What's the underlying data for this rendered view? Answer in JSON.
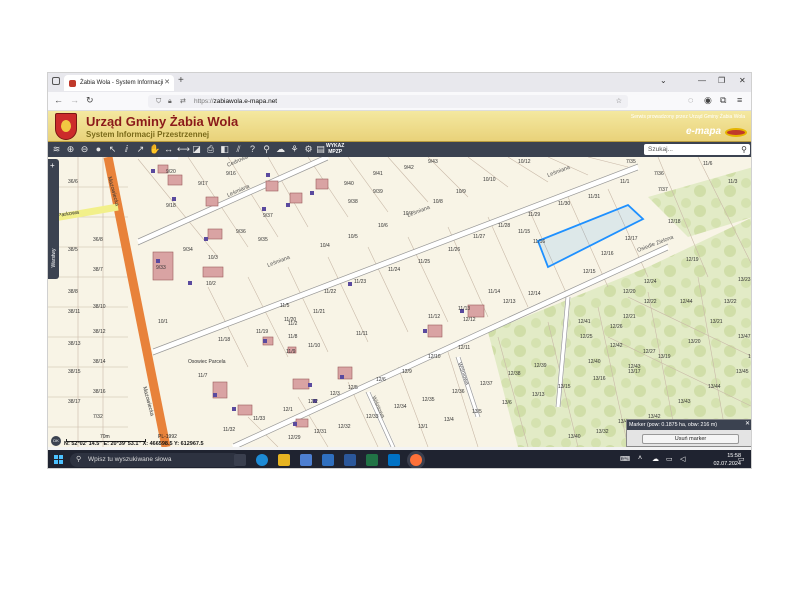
{
  "browser": {
    "tab_title": "Żabia Wola - System Informacji",
    "url_prefix": "https://",
    "url_host": "zabiawola.e-mapa.net"
  },
  "site": {
    "title": "Urząd Gminy Żabia Wola",
    "subtitle": "System Informacji Przestrzennej",
    "powered": "Serwis prowadzony przez Urząd Gminy Żabia Wola",
    "brand": "e-mapa"
  },
  "toolbar": {
    "wykaz_line1": "WYKAZ",
    "wykaz_line2": "MPZP",
    "search_placeholder": "Szukaj..."
  },
  "map": {
    "layers_label": "Warstwy",
    "scale_label": "70m",
    "scale_right": "PL-1992",
    "coords": "N: 52°02' 14.5\"  E: 20°39' 53.1\"  X: 466598.5  Y: 612967.5",
    "streets": [
      "Parkowa",
      "Mazowiecka",
      "Mazowiecka",
      "Leśmiana",
      "Leśmiana",
      "Leśmiana",
      "Leśmiana",
      "Cedrowa",
      "Wiśniowa",
      "Wiśniowa",
      "Osiedle Zielona"
    ],
    "area_label": "Osowiec Parcela",
    "parcels": [
      "9/20",
      "9/18",
      "9/17",
      "9/16",
      "9/34",
      "9/36",
      "9/37",
      "9/35",
      "9/33",
      "9/40",
      "9/41",
      "9/42",
      "9/43",
      "9/38",
      "9/39",
      "10/1",
      "10/2",
      "10/3",
      "10/4",
      "10/5",
      "10/6",
      "10/7",
      "10/8",
      "10/9",
      "10/10",
      "10/12",
      "11/2",
      "11/5",
      "11/7",
      "11/8",
      "11/9",
      "11/10",
      "11/11",
      "11/12",
      "11/13",
      "11/14",
      "11/15",
      "11/16",
      "11/18",
      "11/19",
      "11/20",
      "11/21",
      "11/22",
      "11/23",
      "11/24",
      "11/25",
      "11/26",
      "11/27",
      "11/28",
      "11/29",
      "11/30",
      "11/31",
      "11/32",
      "11/33",
      "12/1",
      "12/2",
      "12/3",
      "12/5",
      "12/6",
      "12/9",
      "12/10",
      "12/11",
      "12/12",
      "12/13",
      "12/14",
      "12/15",
      "12/16",
      "12/17",
      "12/18",
      "12/19",
      "12/20",
      "12/21",
      "12/22",
      "12/24",
      "12/25",
      "12/26",
      "12/27",
      "12/29",
      "12/31",
      "12/32",
      "12/33",
      "12/34",
      "12/35",
      "12/36",
      "12/37",
      "12/38",
      "12/39",
      "12/40",
      "12/41",
      "12/42",
      "12/43",
      "12/44",
      "13/1",
      "13/4",
      "13/5",
      "13/6",
      "13/13",
      "13/15",
      "13/16",
      "13/17",
      "13/19",
      "13/20",
      "13/21",
      "13/22",
      "13/23",
      "13/32",
      "13/40",
      "13/41",
      "13/42",
      "13/43",
      "13/44",
      "13/45",
      "13/46",
      "13/47",
      "36/5",
      "36/6",
      "36/8",
      "38/5",
      "38/7",
      "38/8",
      "38/10",
      "38/11",
      "38/12",
      "38/13",
      "38/14",
      "38/15",
      "38/16",
      "38/17",
      "7/32",
      "7/35",
      "7/36",
      "7/37",
      "11/6",
      "11/1",
      "11/3"
    ]
  },
  "popup": {
    "title": "Marker (pow: 0.1875 ha, obw: 216 m)",
    "button": "Usuń marker"
  },
  "taskbar": {
    "search": "Wpisz tu wyszukiwane słowa",
    "time": "15:58",
    "date": "02.07.2024"
  },
  "colors": {
    "road": "#e8823a",
    "selection": "#1e90ff",
    "building": "#d4a0a0",
    "forest": "#dfe8c0"
  }
}
